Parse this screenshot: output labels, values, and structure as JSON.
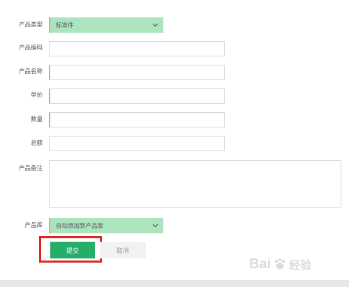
{
  "form": {
    "type_label": "产品类型",
    "type_value": "标准件",
    "code_label": "产品编码",
    "code_value": "",
    "name_label": "产品名称",
    "name_value": "",
    "price_label": "单价",
    "price_value": "",
    "qty_label": "数量",
    "qty_value": "",
    "total_label": "总额",
    "total_value": "",
    "remark_label": "产品备注",
    "remark_value": "",
    "library_label": "产品库",
    "library_value": "自动添加到产品库"
  },
  "actions": {
    "submit_label": "提交",
    "cancel_label": "取消"
  },
  "watermark": {
    "brand": "Bai",
    "brand_suffix": "经验"
  },
  "colors": {
    "select_bg": "#ade4c0",
    "required_marker": "#f0a060",
    "submit_bg": "#26ad6a",
    "highlight": "#e0251c"
  }
}
